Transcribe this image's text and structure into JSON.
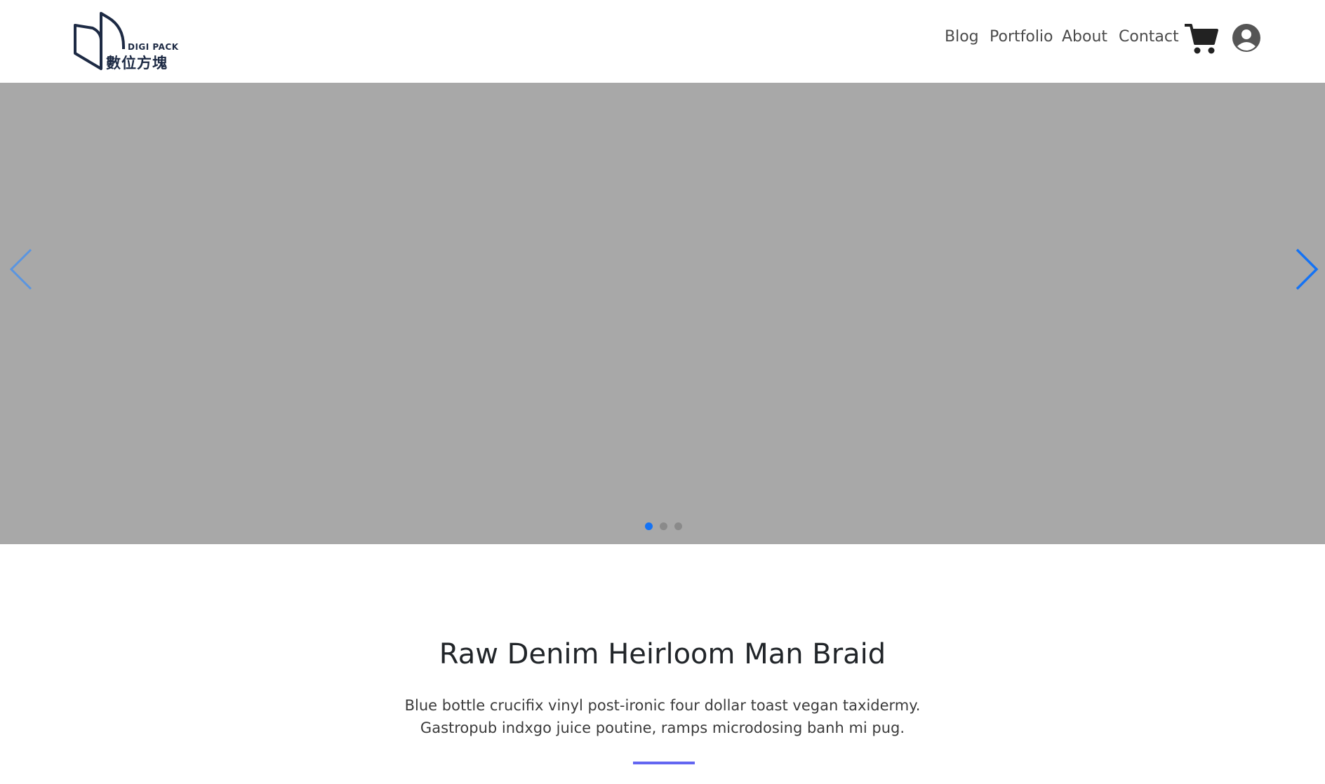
{
  "header": {
    "logo": {
      "name_en": "DIGI PACK",
      "name_zh": "數位方塊"
    },
    "nav": [
      {
        "label": "Blog"
      },
      {
        "label": "Portfolio"
      },
      {
        "label": "About"
      },
      {
        "label": "Contact"
      }
    ],
    "icons": {
      "cart": "shopping-cart-icon",
      "account": "user-avatar-icon"
    }
  },
  "carousel": {
    "slide_count": 3,
    "active_index": 0,
    "colors": {
      "background": "#a8a8a8",
      "active_dot": "#1473f5",
      "inactive_dot": "#8a8a8a",
      "next_arrow": "#1473f5",
      "prev_arrow": "#5a95e0"
    }
  },
  "content": {
    "title": "Raw Denim Heirloom Man Braid",
    "description": "Blue bottle crucifix vinyl post-ironic four dollar toast vegan taxidermy. Gastropub indxgo juice poutine, ramps microdosing banh mi pug.",
    "accent_color": "#6366f1"
  }
}
